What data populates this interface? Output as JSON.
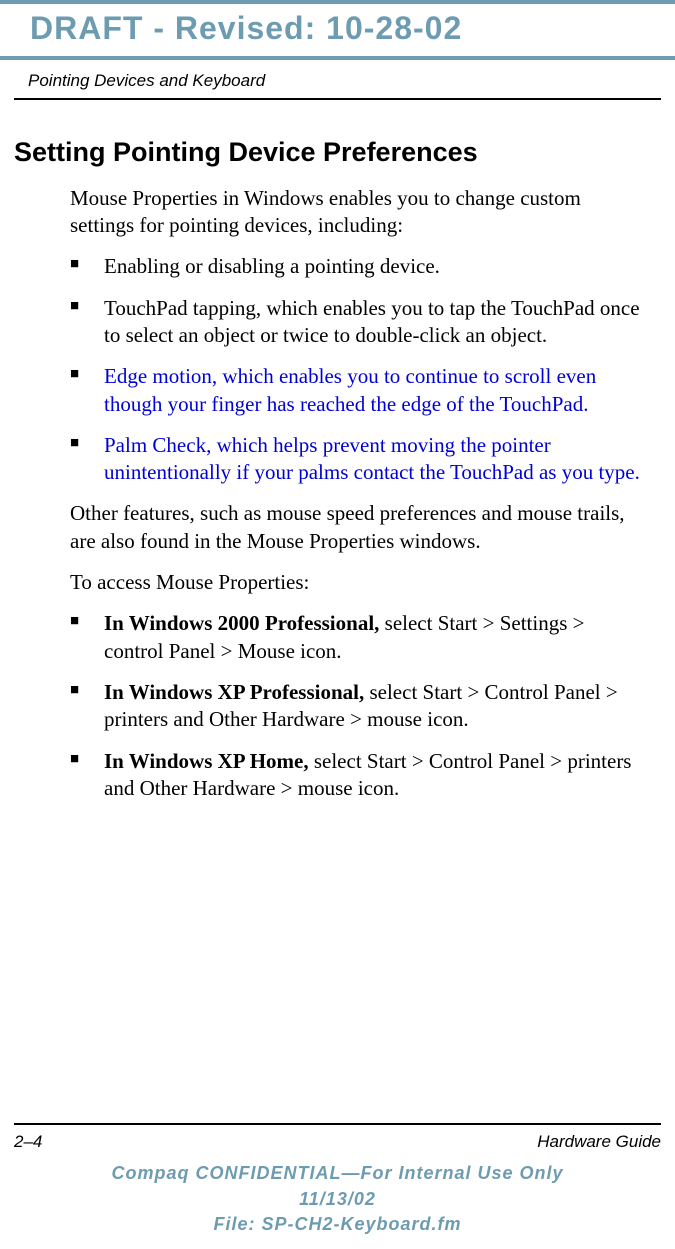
{
  "draft_header": "DRAFT - Revised: 10-28-02",
  "page_header": "Pointing Devices and Keyboard",
  "section_title": "Setting Pointing Device Preferences",
  "intro": "Mouse Properties in Windows enables you to change custom settings for pointing devices, including:",
  "bullets1": [
    {
      "text": "Enabling or disabling a pointing device.",
      "class": ""
    },
    {
      "text": "TouchPad tapping, which enables you to tap the TouchPad once to select an object or twice to double-click an object.",
      "class": ""
    },
    {
      "text": "Edge motion, which enables you to continue to scroll even though your finger has reached the edge of the TouchPad.",
      "class": "blue"
    },
    {
      "text": "Palm Check, which helps prevent moving the pointer unintentionally if your palms contact the TouchPad as you type.",
      "class": "blue"
    }
  ],
  "para2": "Other features, such as mouse speed preferences and mouse trails, are also found in the Mouse Properties windows.",
  "para3": "To access Mouse Properties:",
  "bullets2": [
    {
      "bold": "In Windows 2000 Professional,",
      "rest": " select Start > Settings > control Panel > Mouse icon."
    },
    {
      "bold": "In Windows XP Professional,",
      "rest": " select Start > Control Panel > printers and Other Hardware > mouse icon."
    },
    {
      "bold": "In Windows XP Home,",
      "rest": " select Start > Control Panel > printers and Other Hardware > mouse icon."
    }
  ],
  "footer": {
    "page_number": "2–4",
    "guide_name": "Hardware Guide",
    "conf_line1": "Compaq CONFIDENTIAL—For Internal Use Only",
    "conf_line2": "11/13/02",
    "conf_line3": "File: SP-CH2-Keyboard.fm"
  }
}
